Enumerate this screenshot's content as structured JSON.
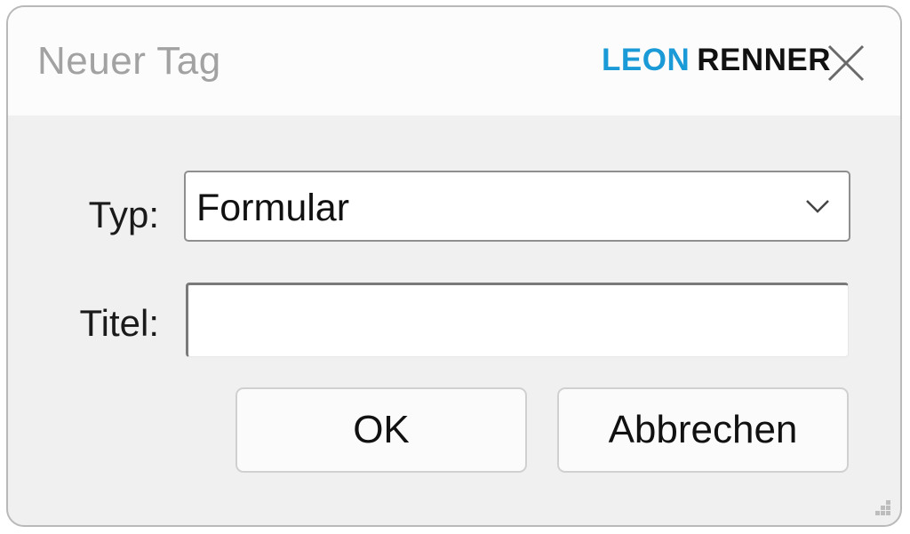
{
  "dialog": {
    "title": "Neuer Tag",
    "close_icon": "close-icon"
  },
  "brand": {
    "first": "LEON",
    "last": "RENNER",
    "first_color": "#1a9ad6",
    "last_color": "#111111"
  },
  "form": {
    "type_label": "Typ:",
    "type_value": "Formular",
    "type_icon": "chevron-down-icon",
    "title_label": "Titel:",
    "title_value": ""
  },
  "buttons": {
    "ok_label": "OK",
    "cancel_label": "Abbrechen"
  },
  "resize_icon": "resize-grip-icon"
}
